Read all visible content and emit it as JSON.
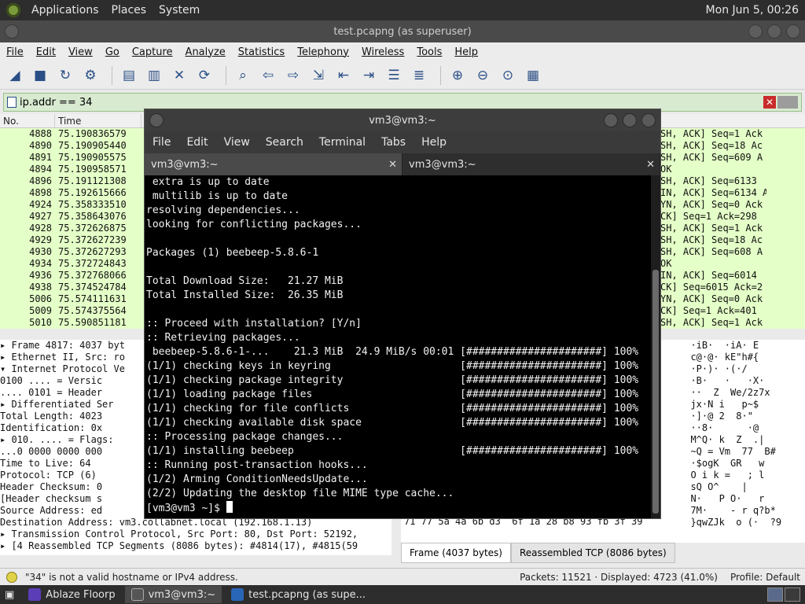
{
  "top_panel": {
    "menus": [
      "Applications",
      "Places",
      "System"
    ],
    "clock": "Mon Jun  5, 00:26"
  },
  "wireshark": {
    "title": "test.pcapng (as superuser)",
    "menu": [
      "File",
      "Edit",
      "View",
      "Go",
      "Capture",
      "Analyze",
      "Statistics",
      "Telephony",
      "Wireless",
      "Tools",
      "Help"
    ],
    "filter_value": "ip.addr == 34",
    "columns": [
      "No.",
      "Time"
    ],
    "packets": [
      {
        "no": "4888",
        "time": "75.190836579",
        "info": "SH, ACK] Seq=1 Ack"
      },
      {
        "no": "4890",
        "time": "75.190905440",
        "info": "SH, ACK] Seq=18 Ac"
      },
      {
        "no": "4891",
        "time": "75.190905575",
        "info": "SH, ACK] Seq=609 A"
      },
      {
        "no": "4894",
        "time": "75.190958571",
        "info": "OK"
      },
      {
        "no": "4896",
        "time": "75.191121308",
        "info": "SH, ACK] Seq=6133"
      },
      {
        "no": "4898",
        "time": "75.192615666",
        "info": "IN, ACK] Seq=6134 Ack=3"
      },
      {
        "no": "4924",
        "time": "75.358333510",
        "info": "YN, ACK] Seq=0 Ack"
      },
      {
        "no": "4927",
        "time": "75.358643076",
        "info": "CK] Seq=1 Ack=298"
      },
      {
        "no": "4928",
        "time": "75.372626875",
        "info": "SH, ACK] Seq=1 Ack"
      },
      {
        "no": "4929",
        "time": "75.372627239",
        "info": "SH, ACK] Seq=18 Ac"
      },
      {
        "no": "4930",
        "time": "75.372627293",
        "info": "SH, ACK] Seq=608 A"
      },
      {
        "no": "4934",
        "time": "75.372724843",
        "info": "OK"
      },
      {
        "no": "4936",
        "time": "75.372768066",
        "info": "IN, ACK] Seq=6014"
      },
      {
        "no": "4938",
        "time": "75.374524784",
        "info": "CK] Seq=6015 Ack=2"
      },
      {
        "no": "5006",
        "time": "75.574111631",
        "info": "YN, ACK] Seq=0 Ack"
      },
      {
        "no": "5009",
        "time": "75.574375564",
        "info": "CK] Seq=1 Ack=401"
      },
      {
        "no": "5010",
        "time": "75.590851181",
        "info": "SH, ACK] Seq=1 Ack"
      }
    ],
    "details": [
      "▸ Frame 4817: 4037 byt",
      "▸ Ethernet II, Src: ro",
      "▾ Internet Protocol Ve",
      "     0100 .... = Versic",
      "     .... 0101 = Header",
      "   ▸ Differentiated Ser",
      "     Total Length: 4023",
      "     Identification: 0x",
      "   ▸ 010. .... = Flags:",
      "     ...0 0000 0000 000",
      "     Time to Live: 64",
      "     Protocol: TCP (6)",
      "     Header Checksum: 0",
      "     [Header checksum s",
      "     Source Address: ed",
      "     Destination Address: vm3.collabnet.local (192.168.1.13)",
      "▸ Transmission Control Protocol, Src Port: 80, Dst Port: 52192,",
      "▸ [4 Reassembled TCP Segments (8086 bytes): #4814(17), #4815(59"
    ],
    "bytes_ascii": [
      "  ·iB·  ·iA· E",
      "  c@·@· kE\"h#{",
      "  ·P·)· ·(·/",
      "  ·B·   ·   ·X·",
      "  ··  Z  We/2z7x",
      "  jx·N i   p~$",
      "  ·]·@ 2  8·\"",
      "  ··8·      ·@",
      "  M^Q· k  Z  .|",
      "  ~Q = Vm  77  B#",
      "  ·$ogK  GR   w",
      "  O i k =   ; l",
      "  sQ O^    |",
      "  N·   P O·   r",
      "  7M·    - r q?b*",
      "  }qwZJk  o (·  ?9"
    ],
    "hex_line": "71 77 5a 4a 6b d3  6f 1a 28 b8 93 fb 3f 39",
    "byte_tabs": [
      "Frame (4037 bytes)",
      "Reassembled TCP (8086 bytes)"
    ],
    "status_msg": "\"34\" is not a valid hostname or IPv4 address.",
    "status_packets": "Packets: 11521 · Displayed: 4723 (41.0%)",
    "status_profile": "Profile: Default"
  },
  "terminal": {
    "title": "vm3@vm3:~",
    "menu": [
      "File",
      "Edit",
      "View",
      "Search",
      "Terminal",
      "Tabs",
      "Help"
    ],
    "tabs": [
      "vm3@vm3:~",
      "vm3@vm3:~"
    ],
    "lines": [
      " extra is up to date",
      " multilib is up to date",
      "resolving dependencies...",
      "looking for conflicting packages...",
      "",
      "Packages (1) beebeep-5.8.6-1",
      "",
      "Total Download Size:   21.27 MiB",
      "Total Installed Size:  26.35 MiB",
      "",
      ":: Proceed with installation? [Y/n]",
      ":: Retrieving packages...",
      " beebeep-5.8.6-1-...    21.3 MiB  24.9 MiB/s 00:01 [######################] 100%",
      "(1/1) checking keys in keyring                     [######################] 100%",
      "(1/1) checking package integrity                   [######################] 100%",
      "(1/1) loading package files                        [######################] 100%",
      "(1/1) checking for file conflicts                  [######################] 100%",
      "(1/1) checking available disk space                [######################] 100%",
      ":: Processing package changes...",
      "(1/1) installing beebeep                           [######################] 100%",
      ":: Running post-transaction hooks...",
      "(1/2) Arming ConditionNeedsUpdate...",
      "(2/2) Updating the desktop file MIME type cache..."
    ],
    "prompt": "[vm3@vm3 ~]$ "
  },
  "taskbar": {
    "tasks": [
      "Ablaze Floorp",
      "vm3@vm3:~",
      "test.pcapng (as supe..."
    ]
  }
}
